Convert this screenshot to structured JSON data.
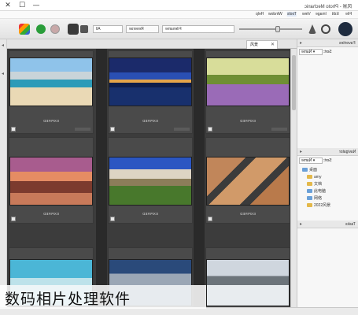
{
  "window": {
    "title": "风景 - Photo Mechanic",
    "minimize": "—",
    "maximize": "☐",
    "close": "✕"
  },
  "menu": [
    "File",
    "Edit",
    "Image",
    "View",
    "Tools",
    "Window",
    "Help"
  ],
  "toolbar": {
    "filename_field": "Filename",
    "reverse_label": "Reverse",
    "all_label": "All"
  },
  "tab": {
    "label": "风景",
    "close": "✕"
  },
  "grid": {
    "cells": [
      {
        "label": "EXPIRED",
        "image": "beach-city"
      },
      {
        "label": "EXPIRED",
        "image": "night-city-lake"
      },
      {
        "label": "EXPIRED",
        "image": "lavender-trees"
      },
      {
        "label": "EXPIRED",
        "image": "coastal-sunset"
      },
      {
        "label": "EXPIRED",
        "image": "mountain-valley"
      },
      {
        "label": "EXPIRED",
        "image": "winding-road"
      },
      {
        "label": "",
        "image": "sea-people"
      },
      {
        "label": "",
        "image": "mountain-lake"
      },
      {
        "label": "",
        "image": "winter-landscape"
      }
    ]
  },
  "favorites": {
    "title": "Favorites",
    "sort_label": "Sort:",
    "sort_value": "Name"
  },
  "navigator": {
    "title": "Navigator",
    "sort_label": "Sort:",
    "sort_value": "Name",
    "items": [
      "桌面",
      "amy",
      "文档",
      "此电脑",
      "网络",
      "2022风景"
    ]
  },
  "tasks": {
    "title": "Tasks"
  },
  "caption": "数码相片处理软件",
  "colors": {
    "content_bg": "#3c3c3c",
    "cell_bg": "#4a4a4a",
    "panel_bg": "#f7f7f7"
  }
}
